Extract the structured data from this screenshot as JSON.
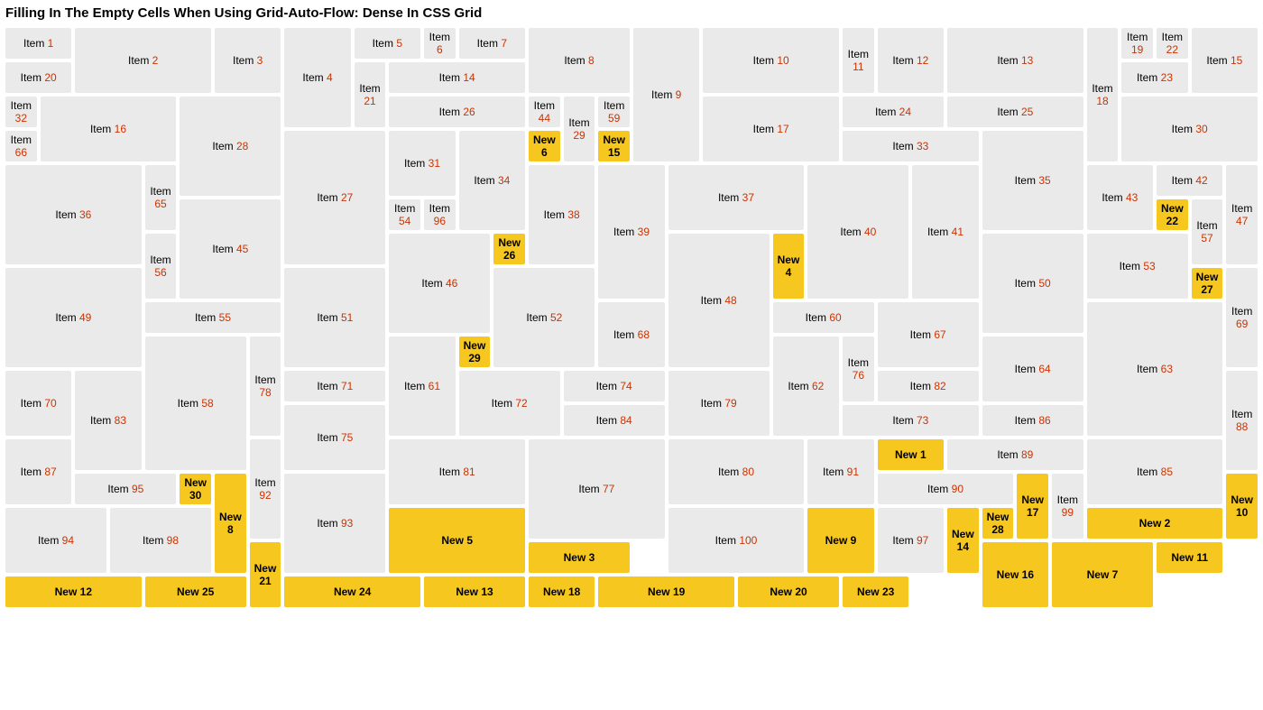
{
  "title": "Filling In The Empty Cells When Using Grid-Auto-Flow: Dense In CSS Grid",
  "itemPrefix": "Item ",
  "newPrefix": "New ",
  "cells": [
    {
      "kind": "item",
      "n": 1,
      "cs": 2,
      "rs": 1
    },
    {
      "kind": "item",
      "n": 2,
      "cs": 4,
      "rs": 2
    },
    {
      "kind": "item",
      "n": 3,
      "cs": 2,
      "rs": 2
    },
    {
      "kind": "item",
      "n": 4,
      "cs": 2,
      "rs": 3
    },
    {
      "kind": "item",
      "n": 5,
      "cs": 2,
      "rs": 1
    },
    {
      "kind": "item",
      "n": 6,
      "cs": 5,
      "rs": 1
    },
    {
      "kind": "item",
      "n": 7,
      "cs": 2,
      "rs": 1
    },
    {
      "kind": "item",
      "n": 8,
      "cs": 3,
      "rs": 2
    },
    {
      "kind": "item",
      "n": 9,
      "cs": 2,
      "rs": 4
    },
    {
      "kind": "item",
      "n": 10,
      "cs": 4,
      "rs": 2
    },
    {
      "kind": "item",
      "n": 11,
      "cs": 1,
      "rs": 2
    },
    {
      "kind": "item",
      "n": 12,
      "cs": 2,
      "rs": 2
    },
    {
      "kind": "item",
      "n": 13,
      "cs": 4,
      "rs": 2
    },
    {
      "kind": "item",
      "n": 18,
      "cs": 1,
      "rs": 4
    },
    {
      "kind": "item",
      "n": 19,
      "cs": 1,
      "rs": 1
    },
    {
      "kind": "item",
      "n": 22,
      "cs": 1,
      "rs": 1
    },
    {
      "kind": "item",
      "n": 15,
      "cs": 2,
      "rs": 2
    },
    {
      "kind": "item",
      "n": 20,
      "cs": 2,
      "rs": 1
    },
    {
      "kind": "item",
      "n": 21,
      "cs": 1,
      "rs": 2
    },
    {
      "kind": "item",
      "n": 14,
      "cs": 4,
      "rs": 1
    },
    {
      "kind": "item",
      "n": 23,
      "cs": 2,
      "rs": 1
    },
    {
      "kind": "item",
      "n": 32,
      "cs": 1,
      "rs": 1
    },
    {
      "kind": "item",
      "n": 16,
      "cs": 4,
      "rs": 2
    },
    {
      "kind": "item",
      "n": 26,
      "cs": 4,
      "rs": 1
    },
    {
      "kind": "item",
      "n": 17,
      "cs": 4,
      "rs": 2
    },
    {
      "kind": "item",
      "n": 28,
      "cs": 3,
      "rs": 3
    },
    {
      "kind": "item",
      "n": 44,
      "cs": 1,
      "rs": 1
    },
    {
      "kind": "item",
      "n": 24,
      "cs": 3,
      "rs": 1
    },
    {
      "kind": "item",
      "n": 25,
      "cs": 4,
      "rs": 1
    },
    {
      "kind": "item",
      "n": 30,
      "cs": 4,
      "rs": 2
    },
    {
      "kind": "item",
      "n": 29,
      "cs": 1,
      "rs": 2
    },
    {
      "kind": "item",
      "n": 27,
      "cs": 3,
      "rs": 4
    },
    {
      "kind": "item",
      "n": 59,
      "cs": 1,
      "rs": 1
    },
    {
      "kind": "item",
      "n": 31,
      "cs": 2,
      "rs": 2
    },
    {
      "kind": "item",
      "n": 33,
      "cs": 4,
      "rs": 1
    },
    {
      "kind": "item",
      "n": 34,
      "cs": 2,
      "rs": 3
    },
    {
      "kind": "item",
      "n": 35,
      "cs": 3,
      "rs": 3
    },
    {
      "kind": "item",
      "n": 36,
      "cs": 4,
      "rs": 3
    },
    {
      "kind": "item",
      "n": 38,
      "cs": 2,
      "rs": 3
    },
    {
      "kind": "item",
      "n": 66,
      "cs": 1,
      "rs": 1
    },
    {
      "kind": "item",
      "n": 39,
      "cs": 2,
      "rs": 4
    },
    {
      "kind": "new",
      "n": 6,
      "cs": 1,
      "rs": 1
    },
    {
      "kind": "item",
      "n": 37,
      "cs": 4,
      "rs": 2
    },
    {
      "kind": "item",
      "n": 40,
      "cs": 3,
      "rs": 4
    },
    {
      "kind": "item",
      "n": 41,
      "cs": 2,
      "rs": 4
    },
    {
      "kind": "item",
      "n": 43,
      "cs": 2,
      "rs": 2
    },
    {
      "kind": "item",
      "n": 65,
      "cs": 1,
      "rs": 2
    },
    {
      "kind": "item",
      "n": 42,
      "cs": 2,
      "rs": 1
    },
    {
      "kind": "item",
      "n": 47,
      "cs": 1,
      "rs": 3
    },
    {
      "kind": "item",
      "n": 45,
      "cs": 3,
      "rs": 3
    },
    {
      "kind": "item",
      "n": 46,
      "cs": 3,
      "rs": 3
    },
    {
      "kind": "new",
      "n": 15,
      "cs": 1,
      "rs": 1
    },
    {
      "kind": "item",
      "n": 48,
      "cs": 3,
      "rs": 4
    },
    {
      "kind": "item",
      "n": 54,
      "cs": 1,
      "rs": 1
    },
    {
      "kind": "item",
      "n": 50,
      "cs": 3,
      "rs": 3
    },
    {
      "kind": "item",
      "n": 53,
      "cs": 3,
      "rs": 2
    },
    {
      "kind": "item",
      "n": 96,
      "cs": 1,
      "rs": 1
    },
    {
      "kind": "item",
      "n": 49,
      "cs": 4,
      "rs": 3
    },
    {
      "kind": "item",
      "n": 51,
      "cs": 3,
      "rs": 3
    },
    {
      "kind": "item",
      "n": 52,
      "cs": 3,
      "rs": 3
    },
    {
      "kind": "item",
      "n": 55,
      "cs": 4,
      "rs": 1
    },
    {
      "kind": "item",
      "n": 57,
      "cs": 1,
      "rs": 2
    },
    {
      "kind": "item",
      "n": 56,
      "cs": 1,
      "rs": 2
    },
    {
      "kind": "item",
      "n": 60,
      "cs": 3,
      "rs": 1
    },
    {
      "kind": "item",
      "n": 67,
      "cs": 3,
      "rs": 2
    },
    {
      "kind": "item",
      "n": 63,
      "cs": 4,
      "rs": 4
    },
    {
      "kind": "item",
      "n": 58,
      "cs": 3,
      "rs": 4
    },
    {
      "kind": "item",
      "n": 68,
      "cs": 2,
      "rs": 2
    },
    {
      "kind": "item",
      "n": 69,
      "cs": 1,
      "rs": 3
    },
    {
      "kind": "item",
      "n": 78,
      "cs": 1,
      "rs": 3
    },
    {
      "kind": "item",
      "n": 61,
      "cs": 2,
      "rs": 3
    },
    {
      "kind": "item",
      "n": 62,
      "cs": 2,
      "rs": 3
    },
    {
      "kind": "item",
      "n": 64,
      "cs": 3,
      "rs": 2
    },
    {
      "kind": "item",
      "n": 70,
      "cs": 2,
      "rs": 2
    },
    {
      "kind": "item",
      "n": 71,
      "cs": 3,
      "rs": 1
    },
    {
      "kind": "item",
      "n": 72,
      "cs": 3,
      "rs": 2
    },
    {
      "kind": "new",
      "n": 4,
      "cs": 1,
      "rs": 2
    },
    {
      "kind": "item",
      "n": 74,
      "cs": 3,
      "rs": 1
    },
    {
      "kind": "new",
      "n": 22,
      "cs": 1,
      "rs": 1
    },
    {
      "kind": "item",
      "n": 76,
      "cs": 1,
      "rs": 2
    },
    {
      "kind": "item",
      "n": 79,
      "cs": 3,
      "rs": 2
    },
    {
      "kind": "item",
      "n": 73,
      "cs": 4,
      "rs": 1
    },
    {
      "kind": "item",
      "n": 83,
      "cs": 2,
      "rs": 3
    },
    {
      "kind": "item",
      "n": 75,
      "cs": 3,
      "rs": 2
    },
    {
      "kind": "item",
      "n": 82,
      "cs": 3,
      "rs": 1
    },
    {
      "kind": "item",
      "n": 88,
      "cs": 1,
      "rs": 3
    },
    {
      "kind": "item",
      "n": 81,
      "cs": 4,
      "rs": 2
    },
    {
      "kind": "item",
      "n": 84,
      "cs": 3,
      "rs": 1
    },
    {
      "kind": "new",
      "n": 26,
      "cs": 1,
      "rs": 1
    },
    {
      "kind": "item",
      "n": 77,
      "cs": 4,
      "rs": 3
    },
    {
      "kind": "item",
      "n": 80,
      "cs": 4,
      "rs": 2
    },
    {
      "kind": "item",
      "n": 86,
      "cs": 3,
      "rs": 1
    },
    {
      "kind": "item",
      "n": 87,
      "cs": 2,
      "rs": 2
    },
    {
      "kind": "item",
      "n": 91,
      "cs": 2,
      "rs": 2
    },
    {
      "kind": "new",
      "n": 1,
      "cs": 2,
      "rs": 1
    },
    {
      "kind": "item",
      "n": 89,
      "cs": 4,
      "rs": 1
    },
    {
      "kind": "item",
      "n": 85,
      "cs": 4,
      "rs": 2
    },
    {
      "kind": "item",
      "n": 92,
      "cs": 1,
      "rs": 3
    },
    {
      "kind": "item",
      "n": 95,
      "cs": 3,
      "rs": 1
    },
    {
      "kind": "item",
      "n": 90,
      "cs": 4,
      "rs": 1
    },
    {
      "kind": "item",
      "n": 93,
      "cs": 3,
      "rs": 3
    },
    {
      "kind": "item",
      "n": 94,
      "cs": 3,
      "rs": 2
    },
    {
      "kind": "new",
      "n": 27,
      "cs": 1,
      "rs": 1
    },
    {
      "kind": "item",
      "n": 98,
      "cs": 3,
      "rs": 2
    },
    {
      "kind": "new",
      "n": 8,
      "cs": 1,
      "rs": 3
    },
    {
      "kind": "new",
      "n": 5,
      "cs": 4,
      "rs": 2
    },
    {
      "kind": "new",
      "n": 17,
      "cs": 1,
      "rs": 2
    },
    {
      "kind": "item",
      "n": 100,
      "cs": 4,
      "rs": 2
    },
    {
      "kind": "new",
      "n": 9,
      "cs": 2,
      "rs": 2
    },
    {
      "kind": "item",
      "n": 97,
      "cs": 2,
      "rs": 2
    },
    {
      "kind": "item",
      "n": 99,
      "cs": 1,
      "rs": 2
    },
    {
      "kind": "new",
      "n": 2,
      "cs": 4,
      "rs": 1
    },
    {
      "kind": "new",
      "n": 3,
      "cs": 3,
      "rs": 1
    },
    {
      "kind": "new",
      "n": 10,
      "cs": 1,
      "rs": 2
    },
    {
      "kind": "new",
      "n": 14,
      "cs": 1,
      "rs": 2
    },
    {
      "kind": "new",
      "n": 16,
      "cs": 2,
      "rs": 2
    },
    {
      "kind": "new",
      "n": 7,
      "cs": 3,
      "rs": 2
    },
    {
      "kind": "new",
      "n": 11,
      "cs": 2,
      "rs": 1
    },
    {
      "kind": "new",
      "n": 12,
      "cs": 4,
      "rs": 1
    },
    {
      "kind": "new",
      "n": 21,
      "cs": 1,
      "rs": 2
    },
    {
      "kind": "new",
      "n": 24,
      "cs": 4,
      "rs": 1
    },
    {
      "kind": "new",
      "n": 29,
      "cs": 1,
      "rs": 1
    },
    {
      "kind": "new",
      "n": 25,
      "cs": 3,
      "rs": 1
    },
    {
      "kind": "new",
      "n": 30,
      "cs": 1,
      "rs": 1
    },
    {
      "kind": "new",
      "n": 13,
      "cs": 3,
      "rs": 1
    },
    {
      "kind": "new",
      "n": 18,
      "cs": 2,
      "rs": 1
    },
    {
      "kind": "new",
      "n": 28,
      "cs": 1,
      "rs": 1
    },
    {
      "kind": "new",
      "n": 19,
      "cs": 4,
      "rs": 1
    },
    {
      "kind": "new",
      "n": 20,
      "cs": 3,
      "rs": 1
    },
    {
      "kind": "new",
      "n": 23,
      "cs": 2,
      "rs": 1
    }
  ]
}
